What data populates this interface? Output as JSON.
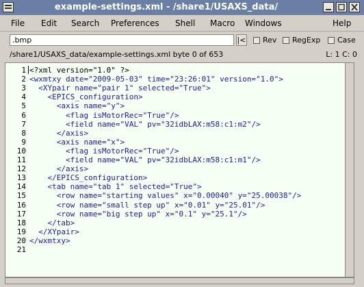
{
  "window": {
    "title": "example-settings.xml - /share1/USAXS_data/"
  },
  "menu": [
    {
      "label": "File"
    },
    {
      "label": "Edit"
    },
    {
      "label": "Search"
    },
    {
      "label": "Preferences"
    },
    {
      "label": "Shell"
    },
    {
      "label": "Macro"
    },
    {
      "label": "Windows"
    },
    {
      "label": "Help"
    }
  ],
  "search": {
    "value": ".bmp",
    "button_label": "|<",
    "options": [
      {
        "label": "Rev",
        "checked": false
      },
      {
        "label": "RegExp",
        "checked": false
      },
      {
        "label": "Case",
        "checked": false
      }
    ]
  },
  "status": {
    "path": "/share1/USAXS_data/example-settings.xml byte 0 of 653",
    "line_col": "L: 1  C: 0"
  },
  "code_lines": [
    {
      "n": "1",
      "text": "<?xml version=\"1.0\" ?>"
    },
    {
      "n": "2",
      "text": "<wxmtxy date=\"2009-05-03\" time=\"23:26:01\" version=\"1.0\">"
    },
    {
      "n": "3",
      "text": "  <XYpair name=\"pair 1\" selected=\"True\">"
    },
    {
      "n": "4",
      "text": "    <EPICS_configuration>"
    },
    {
      "n": "5",
      "text": "      <axis name=\"y\">"
    },
    {
      "n": "6",
      "text": "        <flag isMotorRec=\"True\"/>"
    },
    {
      "n": "7",
      "text": "        <field name=\"VAL\" pv=\"32idbLAX:m58:c1:m2\"/>"
    },
    {
      "n": "8",
      "text": "      </axis>"
    },
    {
      "n": "9",
      "text": "      <axis name=\"x\">"
    },
    {
      "n": "10",
      "text": "        <flag isMotorRec=\"True\"/>"
    },
    {
      "n": "11",
      "text": "        <field name=\"VAL\" pv=\"32idbLAX:m58:c1:m1\"/>"
    },
    {
      "n": "12",
      "text": "      </axis>"
    },
    {
      "n": "13",
      "text": "    </EPICS_configuration>"
    },
    {
      "n": "14",
      "text": "    <tab name=\"tab 1\" selected=\"True\">"
    },
    {
      "n": "15",
      "text": "      <row name=\"starting values\" x=\"0.00040\" y=\"25.00038\"/>"
    },
    {
      "n": "16",
      "text": "      <row name=\"small step up\" x=\"0.01\" y=\"25.01\"/>"
    },
    {
      "n": "17",
      "text": "      <row name=\"big step up\" x=\"0.1\" y=\"25.1\"/>"
    },
    {
      "n": "18",
      "text": "    </tab>"
    },
    {
      "n": "19",
      "text": "  </XYpair>"
    },
    {
      "n": "20",
      "text": "</wxmtxy>"
    },
    {
      "n": "21",
      "text": ""
    }
  ],
  "colors": {
    "titlebar": "#6a7fa3",
    "editor_bg": "#f5fff4",
    "syntax": "#1a1aa0"
  },
  "icons": {
    "window_menu": "window-menu-icon",
    "minimize": "minimize-icon",
    "maximize": "maximize-icon",
    "close": "close-icon"
  }
}
